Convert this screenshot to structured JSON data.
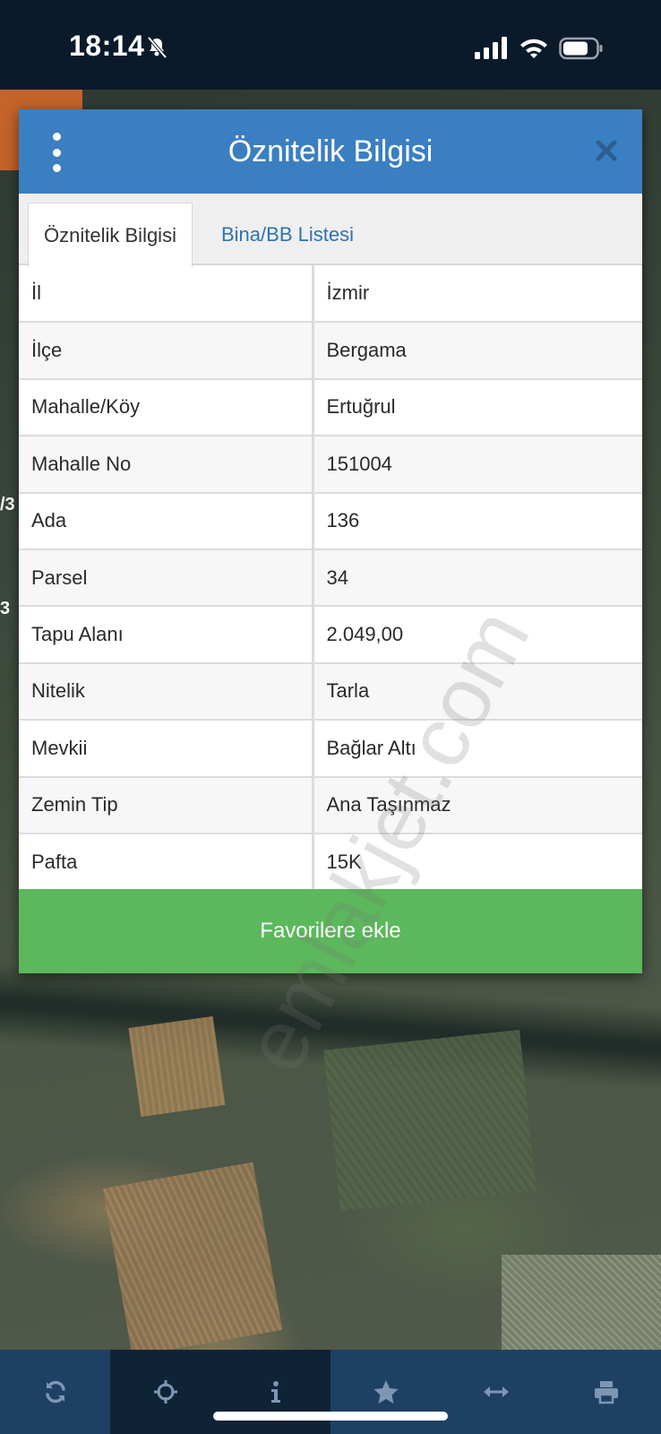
{
  "status_bar": {
    "time": "18:14"
  },
  "map": {
    "edge_labels": [
      "/3",
      "3"
    ]
  },
  "modal": {
    "title": "Öznitelik Bilgisi",
    "tabs": [
      {
        "label": "Öznitelik Bilgisi",
        "active": true
      },
      {
        "label": "Bina/BB Listesi",
        "active": false
      }
    ],
    "rows": [
      {
        "key": "İl",
        "value": "İzmir"
      },
      {
        "key": "İlçe",
        "value": "Bergama"
      },
      {
        "key": "Mahalle/Köy",
        "value": "Ertuğrul"
      },
      {
        "key": "Mahalle No",
        "value": "151004"
      },
      {
        "key": "Ada",
        "value": "136"
      },
      {
        "key": "Parsel",
        "value": "34"
      },
      {
        "key": "Tapu Alanı",
        "value": "2.049,00"
      },
      {
        "key": "Nitelik",
        "value": "Tarla"
      },
      {
        "key": "Mevkii",
        "value": "Bağlar Altı"
      },
      {
        "key": "Zemin Tip",
        "value": "Ana Taşınmaz"
      },
      {
        "key": "Pafta",
        "value": "15K"
      }
    ],
    "favorite_button": "Favorilere ekle"
  },
  "watermark": "emlakjet.com",
  "toolbar": {
    "items": [
      {
        "icon": "refresh-icon"
      },
      {
        "icon": "crosshair-icon"
      },
      {
        "icon": "info-icon",
        "active": true
      },
      {
        "icon": "star-icon"
      },
      {
        "icon": "measure-arrows-icon"
      },
      {
        "icon": "print-icon"
      }
    ]
  },
  "colors": {
    "header": "#3a7fc1",
    "button": "#5cb85c",
    "toolbar": "#1e4063",
    "tab_link": "#2f73b3"
  }
}
